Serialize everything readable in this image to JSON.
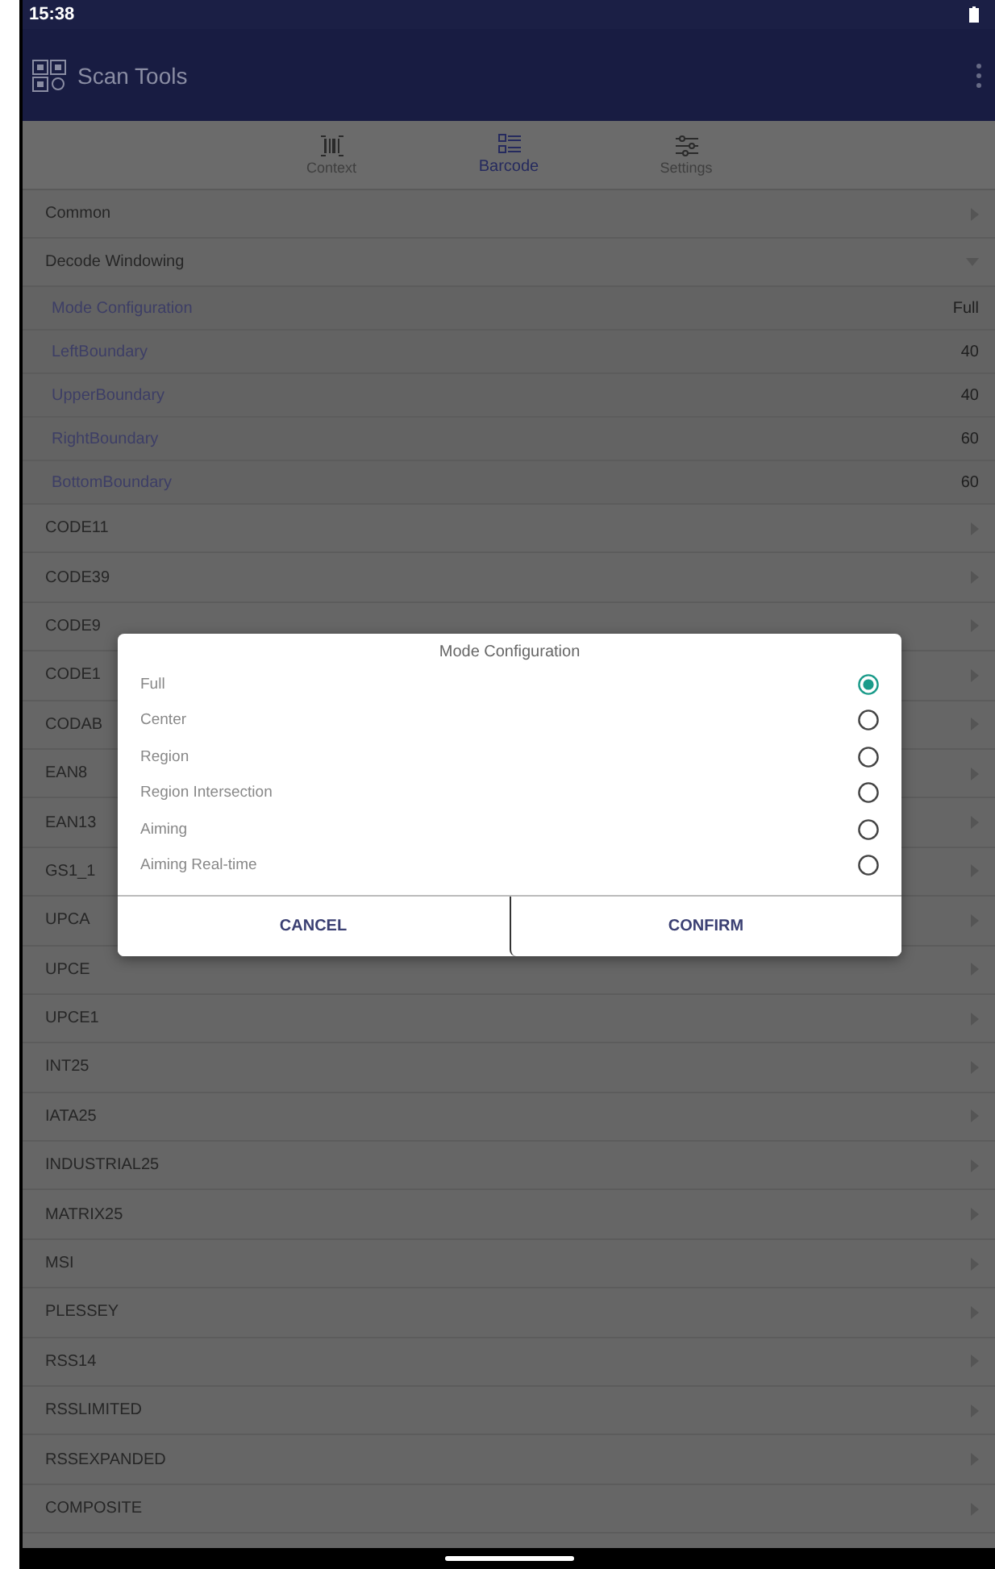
{
  "status_bar": {
    "time": "15:38"
  },
  "app_bar": {
    "title": "Scan Tools"
  },
  "tabs": [
    {
      "label": "Context",
      "selected": false,
      "kind": "barcode"
    },
    {
      "label": "Barcode",
      "selected": true,
      "kind": "list"
    },
    {
      "label": "Settings",
      "selected": false,
      "kind": "sliders"
    }
  ],
  "sections": [
    {
      "label": "Common",
      "expanded": false
    },
    {
      "label": "Decode Windowing",
      "expanded": true,
      "children": [
        {
          "label": "Mode Configuration",
          "value": "Full"
        },
        {
          "label": "LeftBoundary",
          "value": "40"
        },
        {
          "label": "UpperBoundary",
          "value": "40"
        },
        {
          "label": "RightBoundary",
          "value": "60"
        },
        {
          "label": "BottomBoundary",
          "value": "60"
        }
      ]
    },
    {
      "label": "CODE11",
      "expanded": false
    },
    {
      "label": "CODE39",
      "expanded": false
    },
    {
      "label": "CODE9",
      "expanded": false
    },
    {
      "label": "CODE1",
      "expanded": false
    },
    {
      "label": "CODAB",
      "expanded": false
    },
    {
      "label": "EAN8",
      "expanded": false
    },
    {
      "label": "EAN13",
      "expanded": false
    },
    {
      "label": "GS1_1",
      "expanded": false
    },
    {
      "label": "UPCA",
      "expanded": false
    },
    {
      "label": "UPCE",
      "expanded": false
    },
    {
      "label": "UPCE1",
      "expanded": false
    },
    {
      "label": "INT25",
      "expanded": false
    },
    {
      "label": "IATA25",
      "expanded": false
    },
    {
      "label": "INDUSTRIAL25",
      "expanded": false
    },
    {
      "label": "MATRIX25",
      "expanded": false
    },
    {
      "label": "MSI",
      "expanded": false
    },
    {
      "label": "PLESSEY",
      "expanded": false
    },
    {
      "label": "RSS14",
      "expanded": false
    },
    {
      "label": "RSSLIMITED",
      "expanded": false
    },
    {
      "label": "RSSEXPANDED",
      "expanded": false
    },
    {
      "label": "COMPOSITE",
      "expanded": false
    }
  ],
  "dialog": {
    "title": "Mode Configuration",
    "options": [
      {
        "label": "Full",
        "selected": true
      },
      {
        "label": "Center",
        "selected": false
      },
      {
        "label": "Region",
        "selected": false
      },
      {
        "label": "Region Intersection",
        "selected": false
      },
      {
        "label": "Aiming",
        "selected": false
      },
      {
        "label": "Aiming Real-time",
        "selected": false
      }
    ],
    "buttons": [
      "CANCEL",
      "CONFIRM"
    ]
  }
}
